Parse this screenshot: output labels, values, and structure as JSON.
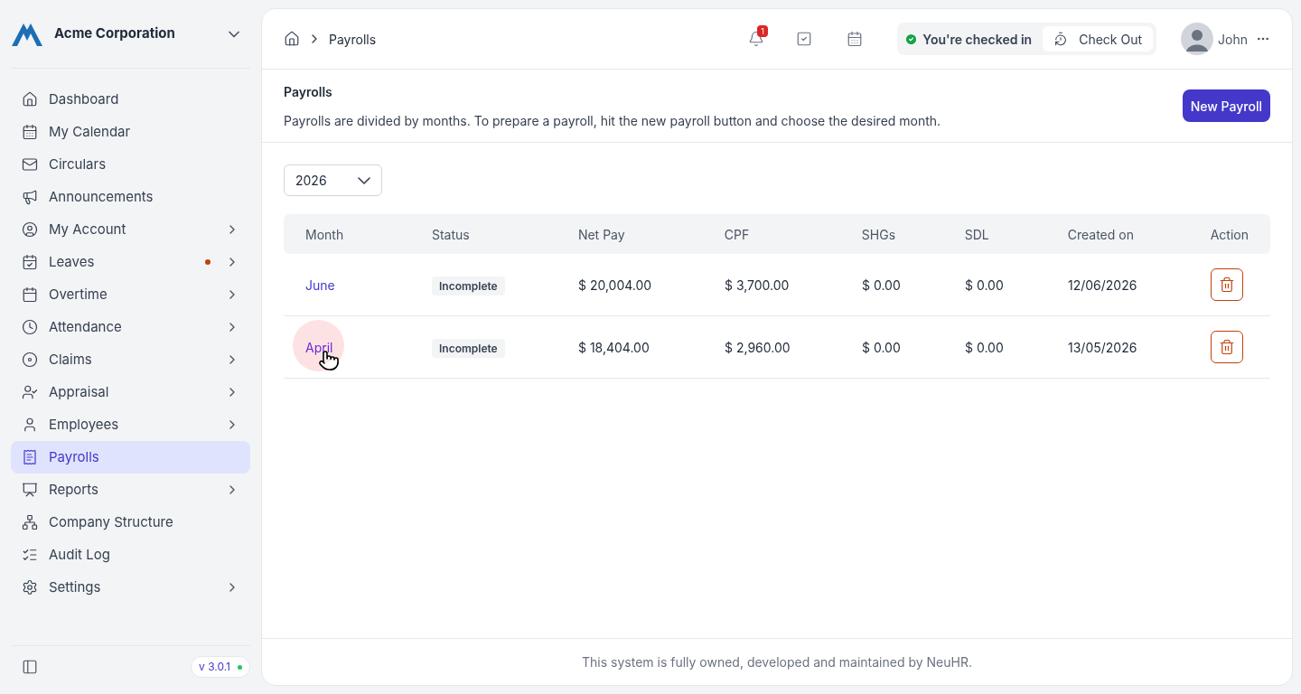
{
  "sidebar": {
    "company": "Acme Corporation",
    "items": [
      {
        "label": "Dashboard",
        "expandable": false,
        "notification": false,
        "selected": false
      },
      {
        "label": "My Calendar",
        "expandable": false,
        "notification": false,
        "selected": false
      },
      {
        "label": "Circulars",
        "expandable": false,
        "notification": false,
        "selected": false
      },
      {
        "label": "Announcements",
        "expandable": false,
        "notification": false,
        "selected": false
      },
      {
        "label": "My Account",
        "expandable": true,
        "notification": false,
        "selected": false
      },
      {
        "label": "Leaves",
        "expandable": true,
        "notification": true,
        "selected": false
      },
      {
        "label": "Overtime",
        "expandable": true,
        "notification": false,
        "selected": false
      },
      {
        "label": "Attendance",
        "expandable": true,
        "notification": false,
        "selected": false
      },
      {
        "label": "Claims",
        "expandable": true,
        "notification": false,
        "selected": false
      },
      {
        "label": "Appraisal",
        "expandable": true,
        "notification": false,
        "selected": false
      },
      {
        "label": "Employees",
        "expandable": true,
        "notification": false,
        "selected": false
      },
      {
        "label": "Payrolls",
        "expandable": false,
        "notification": false,
        "selected": true
      },
      {
        "label": "Reports",
        "expandable": true,
        "notification": false,
        "selected": false
      },
      {
        "label": "Company Structure",
        "expandable": false,
        "notification": false,
        "selected": false
      },
      {
        "label": "Audit Log",
        "expandable": false,
        "notification": false,
        "selected": false
      },
      {
        "label": "Settings",
        "expandable": true,
        "notification": false,
        "selected": false
      }
    ],
    "version": "v 3.0.1"
  },
  "header": {
    "breadcrumb": "Payrolls",
    "notification_count": "1",
    "check_status": "You're checked in",
    "check_out": "Check Out",
    "user": "John"
  },
  "page": {
    "title": "Payrolls",
    "description": "Payrolls are divided by months. To prepare a payroll, hit the new payroll button and choose the desired month.",
    "new_button": "New Payroll",
    "year": "2026"
  },
  "table": {
    "columns": [
      "Month",
      "Status",
      "Net Pay",
      "CPF",
      "SHGs",
      "SDL",
      "Created on",
      "Action"
    ],
    "rows": [
      {
        "month": "June",
        "status": "Incomplete",
        "net_pay": "$ 20,004.00",
        "cpf": "$ 3,700.00",
        "shgs": "$ 0.00",
        "sdl": "$ 0.00",
        "created_on": "12/06/2026",
        "hovered": false
      },
      {
        "month": "April",
        "status": "Incomplete",
        "net_pay": "$ 18,404.00",
        "cpf": "$ 2,960.00",
        "shgs": "$ 0.00",
        "sdl": "$ 0.00",
        "created_on": "13/05/2026",
        "hovered": true
      }
    ]
  },
  "footer": "This system is fully owned, developed and maintained by NeuHR."
}
